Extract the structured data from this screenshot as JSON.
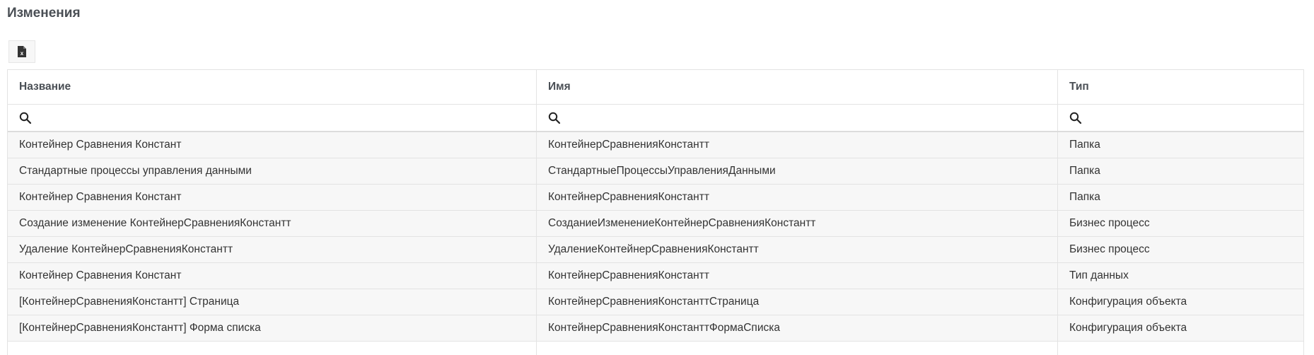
{
  "page": {
    "title": "Изменения"
  },
  "toolbar": {
    "export_icon": "excel-file-icon"
  },
  "table": {
    "columns": [
      "Название",
      "Имя",
      "Тип"
    ],
    "filter_icon": "search-icon",
    "rows": [
      [
        "Контейнер Сравнения Констант",
        "КонтейнерСравненияКонстантт",
        "Папка"
      ],
      [
        "Стандартные процессы управления данными",
        "СтандартныеПроцессыУправленияДанными",
        "Папка"
      ],
      [
        "Контейнер Сравнения Констант",
        "КонтейнерСравненияКонстантт",
        "Папка"
      ],
      [
        "Создание изменение КонтейнерСравненияКонстантт",
        "СозданиеИзменениеКонтейнерСравненияКонстантт",
        "Бизнес процесс"
      ],
      [
        "Удаление КонтейнерСравненияКонстантт",
        "УдалениеКонтейнерСравненияКонстантт",
        "Бизнес процесс"
      ],
      [
        "Контейнер Сравнения Констант",
        "КонтейнерСравненияКонстантт",
        "Тип данных"
      ],
      [
        "[КонтейнерСравненияКонстантт] Страница",
        "КонтейнерСравненияКонстанттСтраница",
        "Конфигурация объекта"
      ],
      [
        "[КонтейнерСравненияКонстантт] Форма списка",
        "КонтейнерСравненияКонстанттФормаСписка",
        "Конфигурация объекта"
      ]
    ]
  }
}
